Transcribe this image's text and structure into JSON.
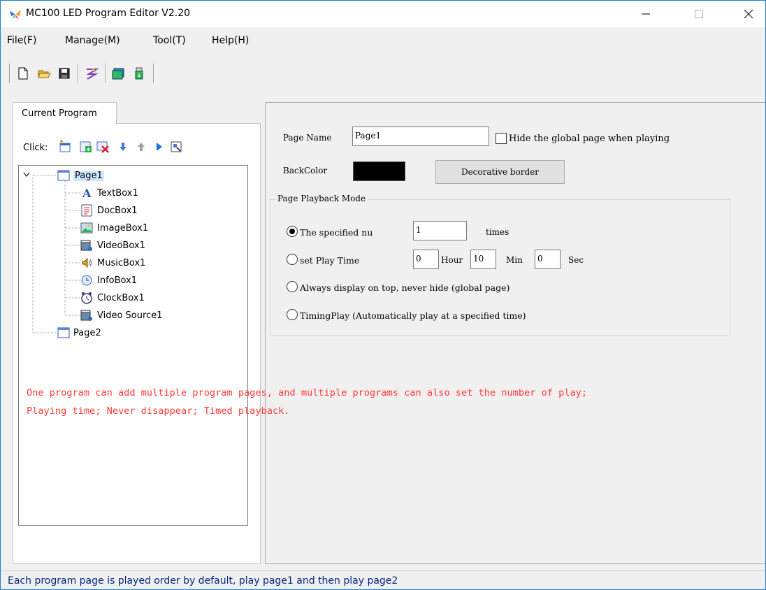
{
  "window": {
    "title": "MC100 LED Program Editor V2.20",
    "minimize": "—",
    "maximize": "☐",
    "close": "✕"
  },
  "menu": [
    "File(F)",
    "Manage(M)",
    "Tool(T)",
    "Help(H)"
  ],
  "toolbar_icons": [
    "new-file-icon",
    "open-folder-icon",
    "save-icon",
    "send-icon",
    "screen-icon",
    "usb-export-icon"
  ],
  "left": {
    "tab": "Current Program",
    "click_label": "Click:",
    "click_icons": [
      "add-page-icon",
      "add-item-icon",
      "delete-icon",
      "move-down-icon",
      "move-up-icon",
      "play-icon",
      "preview-icon"
    ],
    "tree": {
      "pages": [
        {
          "label": "Page1",
          "children": [
            "TextBox1",
            "DocBox1",
            "ImageBox1",
            "VideoBox1",
            "MusicBox1",
            "InfoBox1",
            "ClockBox1",
            "Video Source1"
          ]
        },
        {
          "label": "Page2",
          "children": []
        }
      ]
    }
  },
  "right": {
    "page_name_label": "Page Name",
    "page_name_value": "Page1",
    "hide_global_label": "Hide the global page when playing",
    "hide_global_checked": false,
    "backcolor_label": "BackColor",
    "backcolor_value": "#000000",
    "decorative_border_button": "Decorative border",
    "playback_group_title": "Page Playback Mode",
    "modes": {
      "specified_label": "The specified nu",
      "specified_value": "1",
      "times_label": "times",
      "play_time_label": "set Play Time",
      "hour_value": "0",
      "hour_label": "Hour",
      "min_value": "10",
      "min_label": "Min",
      "sec_value": "0",
      "sec_label": "Sec",
      "always_label": "Always display on top, never hide (global page)",
      "timing_label": "TimingPlay (Automatically play at a specified time)",
      "selected": "specified"
    }
  },
  "note": {
    "line1": "One program can add multiple program pages, and multiple programs can also set the number of play;",
    "line2": "Playing time; Never disappear; Timed playback."
  },
  "status": "Each program page is played order by default, play page1 and then play page2",
  "colors": {
    "accent": "#1883d7",
    "note": "#ff3b3b",
    "status_text": "#002a80"
  }
}
